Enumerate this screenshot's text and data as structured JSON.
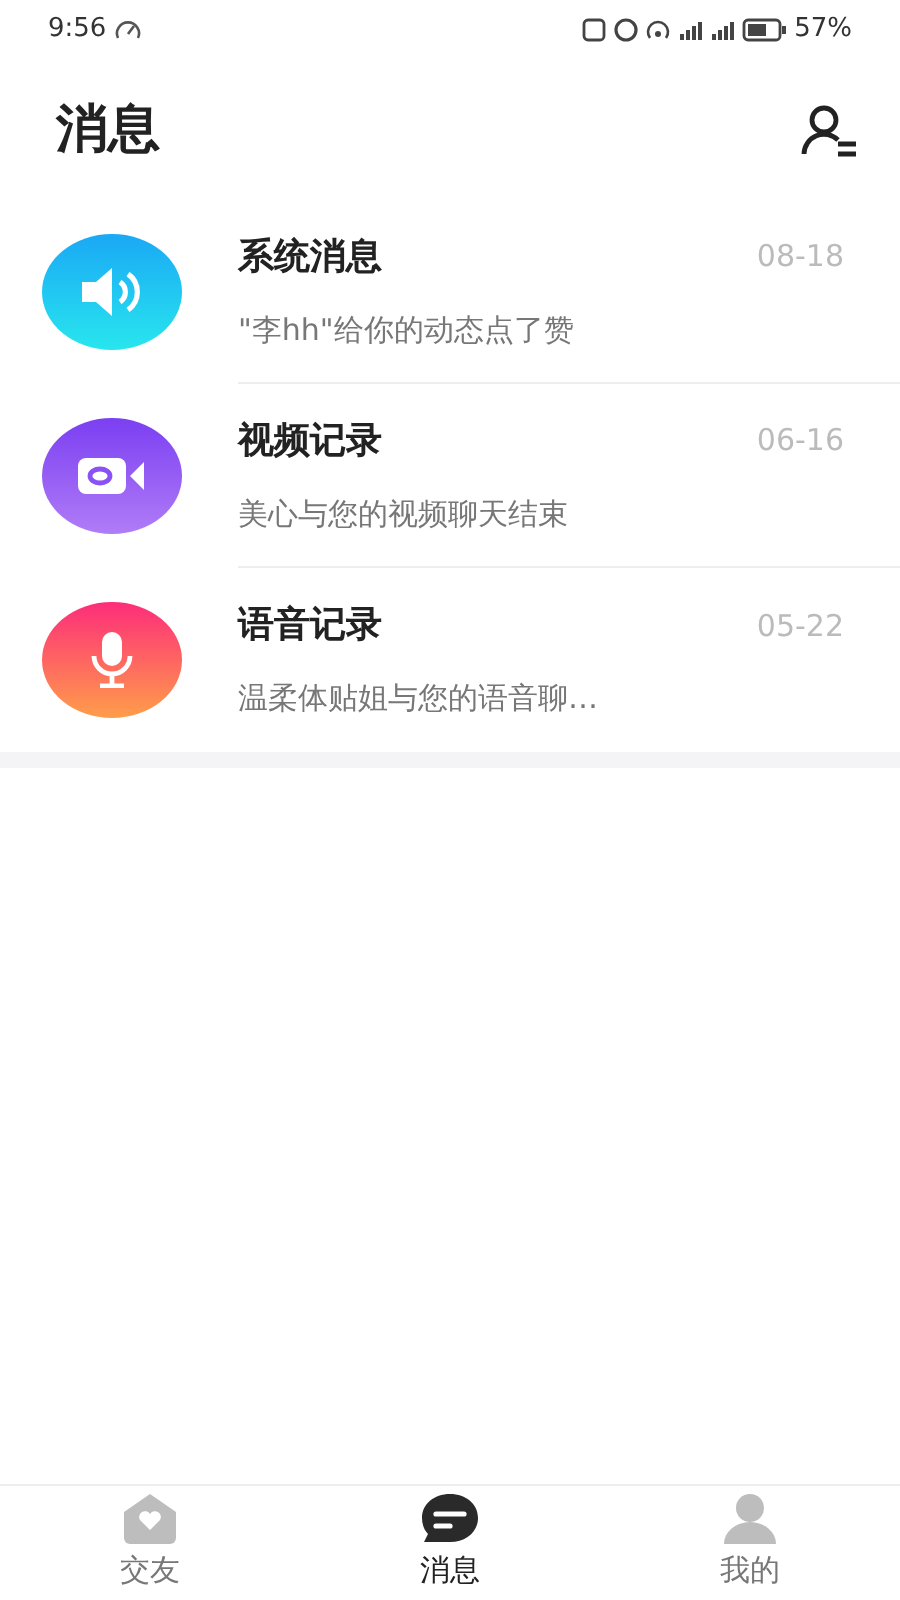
{
  "status_bar": {
    "time": "9:56",
    "battery": "57%"
  },
  "header": {
    "title": "消息"
  },
  "messages": [
    {
      "kind": "system",
      "title": "系统消息",
      "date": "08-18",
      "preview": "\"李hh\"给你的动态点了赞"
    },
    {
      "kind": "video",
      "title": "视频记录",
      "date": "06-16",
      "preview": "美心与您的视频聊天结束"
    },
    {
      "kind": "voice",
      "title": "语音记录",
      "date": "05-22",
      "preview": "温柔体贴姐与您的语音聊…"
    }
  ],
  "tab_bar": [
    {
      "kind": "friends",
      "label": "交友",
      "selected": false
    },
    {
      "kind": "messages",
      "label": "消息",
      "selected": true
    },
    {
      "kind": "me",
      "label": "我的",
      "selected": false
    }
  ]
}
